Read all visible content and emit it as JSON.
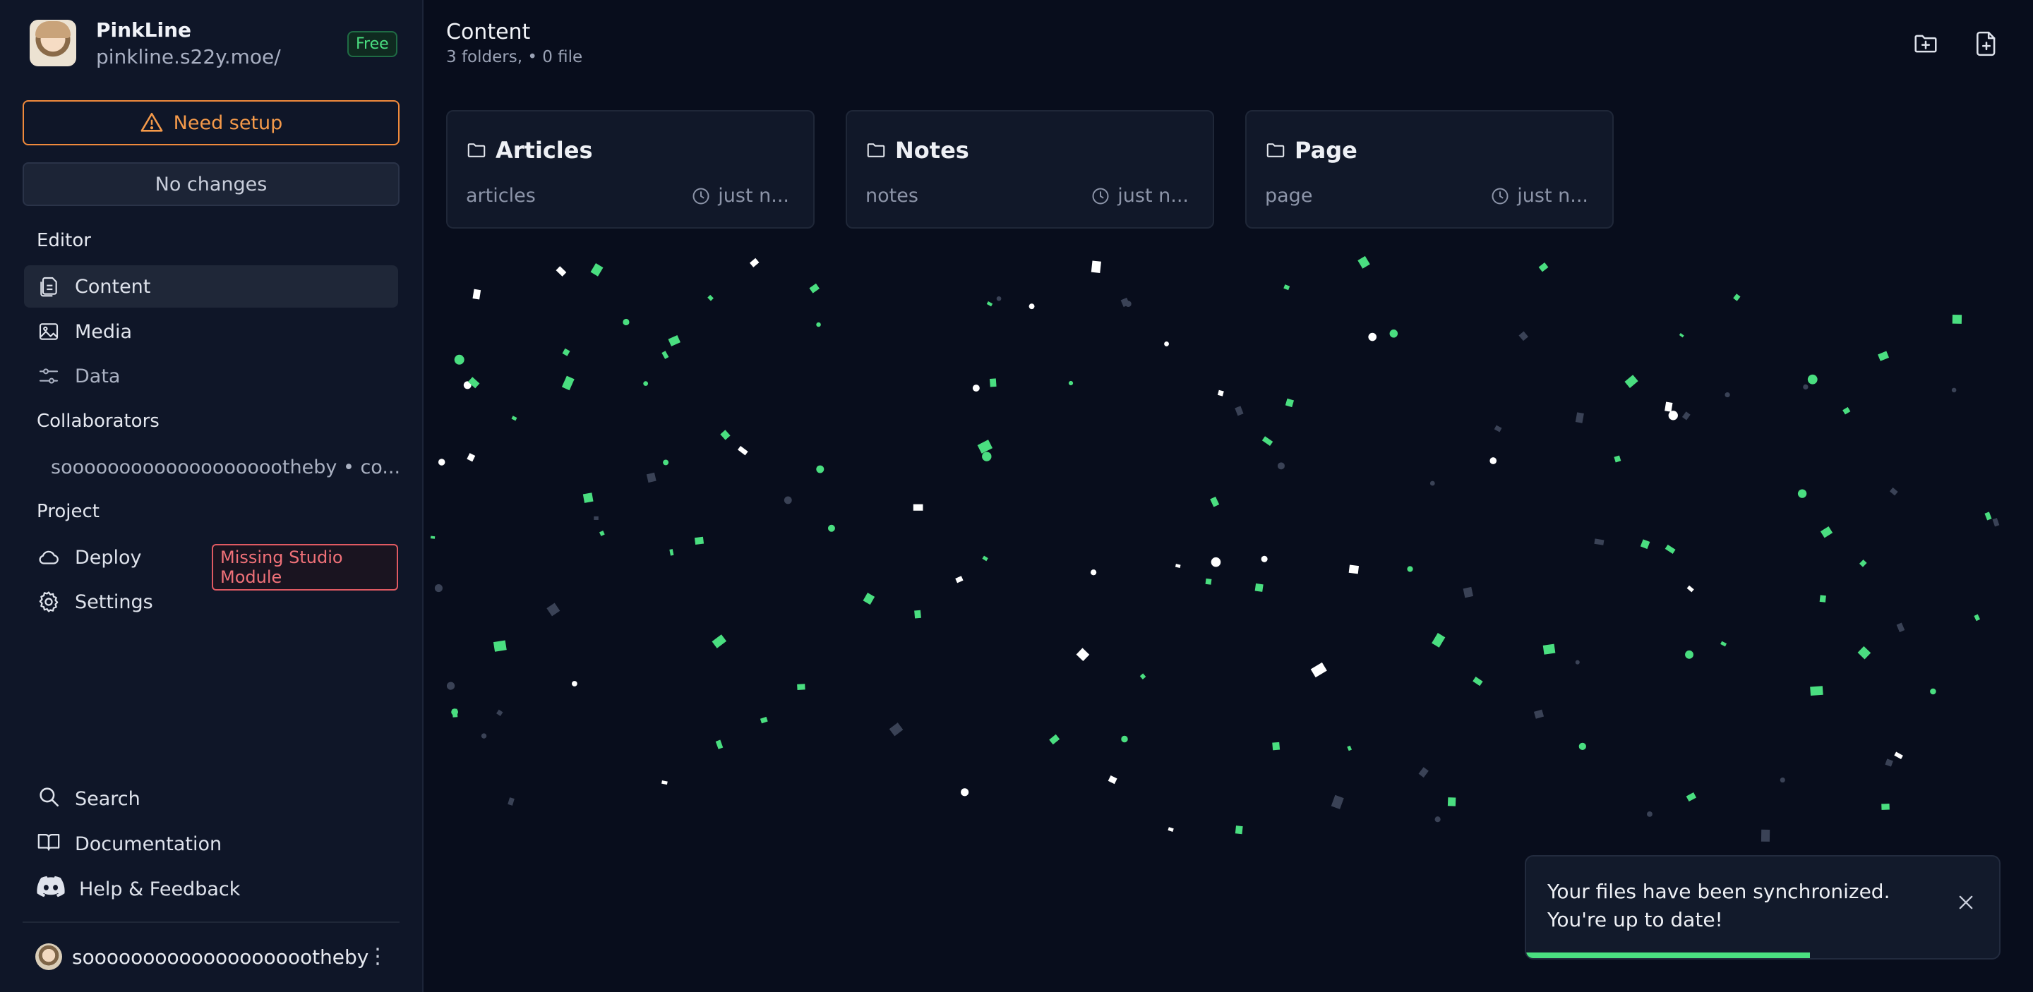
{
  "sidebar": {
    "brand": {
      "name": "PinkLine",
      "url": "pinkline.s22y.moe/",
      "plan": "Free"
    },
    "setup_label": "Need setup",
    "changes_label": "No changes",
    "sections": {
      "editor": "Editor",
      "collaborators": "Collaborators",
      "project": "Project"
    },
    "editor_items": [
      {
        "label": "Content",
        "icon": "files-icon",
        "active": true
      },
      {
        "label": "Media",
        "icon": "image-icon",
        "active": false
      },
      {
        "label": "Data",
        "icon": "sliders-icon",
        "active": false
      }
    ],
    "collaborator": {
      "name": "soooooooooooooooooootheby • co..."
    },
    "project_items": [
      {
        "label": "Deploy",
        "icon": "cloud-icon",
        "badge": "Missing Studio Module"
      },
      {
        "label": "Settings",
        "icon": "gear-icon"
      }
    ],
    "bottom_items": [
      {
        "label": "Search",
        "icon": "search-icon"
      },
      {
        "label": "Documentation",
        "icon": "book-icon"
      },
      {
        "label": "Help & Feedback",
        "icon": "discord-icon"
      }
    ],
    "user": {
      "name": "soooooooooooooooooootheby"
    }
  },
  "main": {
    "title": "Content",
    "subtitle": "3 folders, • 0 file",
    "cards": [
      {
        "title": "Articles",
        "slug": "articles",
        "time": "just n..."
      },
      {
        "title": "Notes",
        "slug": "notes",
        "time": "just n..."
      },
      {
        "title": "Page",
        "slug": "page",
        "time": "just n..."
      }
    ]
  },
  "toast": {
    "message": "Your files have been synchronized. You're up to date!",
    "progress": 0.6
  },
  "colors": {
    "background": "#080d1c",
    "sidebar": "#0f1628",
    "accent_green": "#4ade80",
    "warning_orange": "#f08a3c",
    "danger_red": "#f07178"
  }
}
